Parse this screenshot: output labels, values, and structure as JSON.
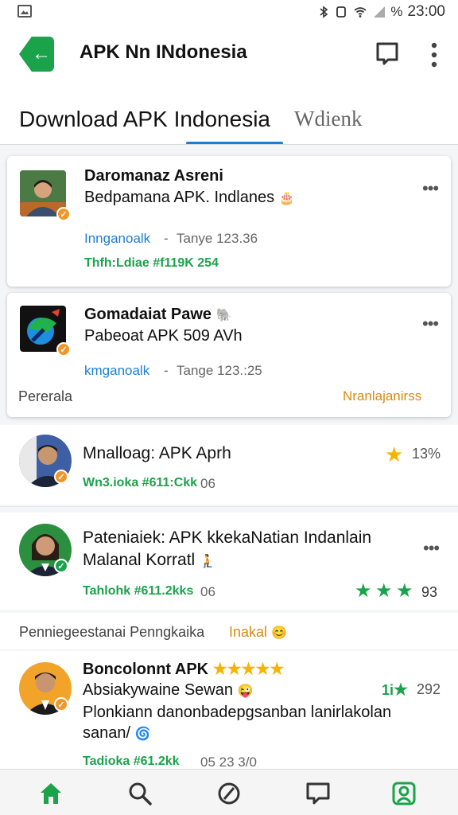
{
  "status_bar": {
    "icons": [
      "gallery-icon",
      "bluetooth-icon",
      "vibrate-icon",
      "wifi-icon",
      "signal-icon"
    ],
    "battery": "%",
    "time": "23:00"
  },
  "header": {
    "title": "APK Nn INdonesia",
    "back_icon": "back-arrow-icon",
    "chat_icon": "message-icon",
    "menu_icon": "more-vert-icon"
  },
  "tabs": [
    {
      "label": "Download APK  Indonesia",
      "active": true
    },
    {
      "label": "Wdienk",
      "active": false
    }
  ],
  "colors": {
    "accent": "#1aa34a",
    "link": "#1c7fd6",
    "tab_indicator": "#1c7fd6",
    "badge_orange": "#f0962a"
  },
  "items": [
    {
      "name": "Daromanaz Asreni",
      "subtitle": "Bedpamana APK. Indlanes",
      "subtitle_emoji": "🎂",
      "link": "Innganoalk",
      "separator": "-",
      "meta": "Tanye 123.36",
      "stats": "Thfh:Ldiae #f119K 254",
      "badge": "orange"
    },
    {
      "name": "Gomadaiat Pawe",
      "name_emoji": "🐘",
      "subtitle": "Pabeoat APK 509 AVh",
      "link": "kmganoalk",
      "separator": "-",
      "meta": "Tange 123.:25",
      "footer_left": "Pererala",
      "footer_right": "Nranlajanirss",
      "badge": "orange"
    },
    {
      "name": "Mnalloag: APK Aprh",
      "stats": "Wn3.ioka #611:Ckk",
      "stats_extra": "06",
      "rating": "13%",
      "badge": "orange"
    },
    {
      "name": "Pateniaiek: APK kkekaNatian Indanlain",
      "subtitle": "Malanal Korratl",
      "subtitle_emoji": "🧎",
      "stats": "Tahlohk #611.2kks",
      "stats_extra": "06",
      "stars_count": 3,
      "rating": "93",
      "badge": "green"
    },
    {
      "section_left": "Penniegeestanai Penngkaika",
      "section_right": "Inakal",
      "section_emoji": "😊"
    },
    {
      "name": "Boncolonnt APK",
      "name_stars": "★★★★★",
      "subtitle": "Absiakywaine Sewan",
      "subtitle_emoji": "😜",
      "rating_prefix": "1i",
      "rating": "292",
      "description": "Plonkiann danonbadepgsanban lanirlakolan",
      "description2": "sanan/",
      "description_emoji": "🌀",
      "stats": "Tadioka #61.2kk",
      "stats_extra": "05  23 3/0",
      "badge": "orange"
    }
  ],
  "bottom_nav": [
    "home-icon",
    "search-icon",
    "block-icon",
    "chat-icon",
    "profile-icon"
  ]
}
